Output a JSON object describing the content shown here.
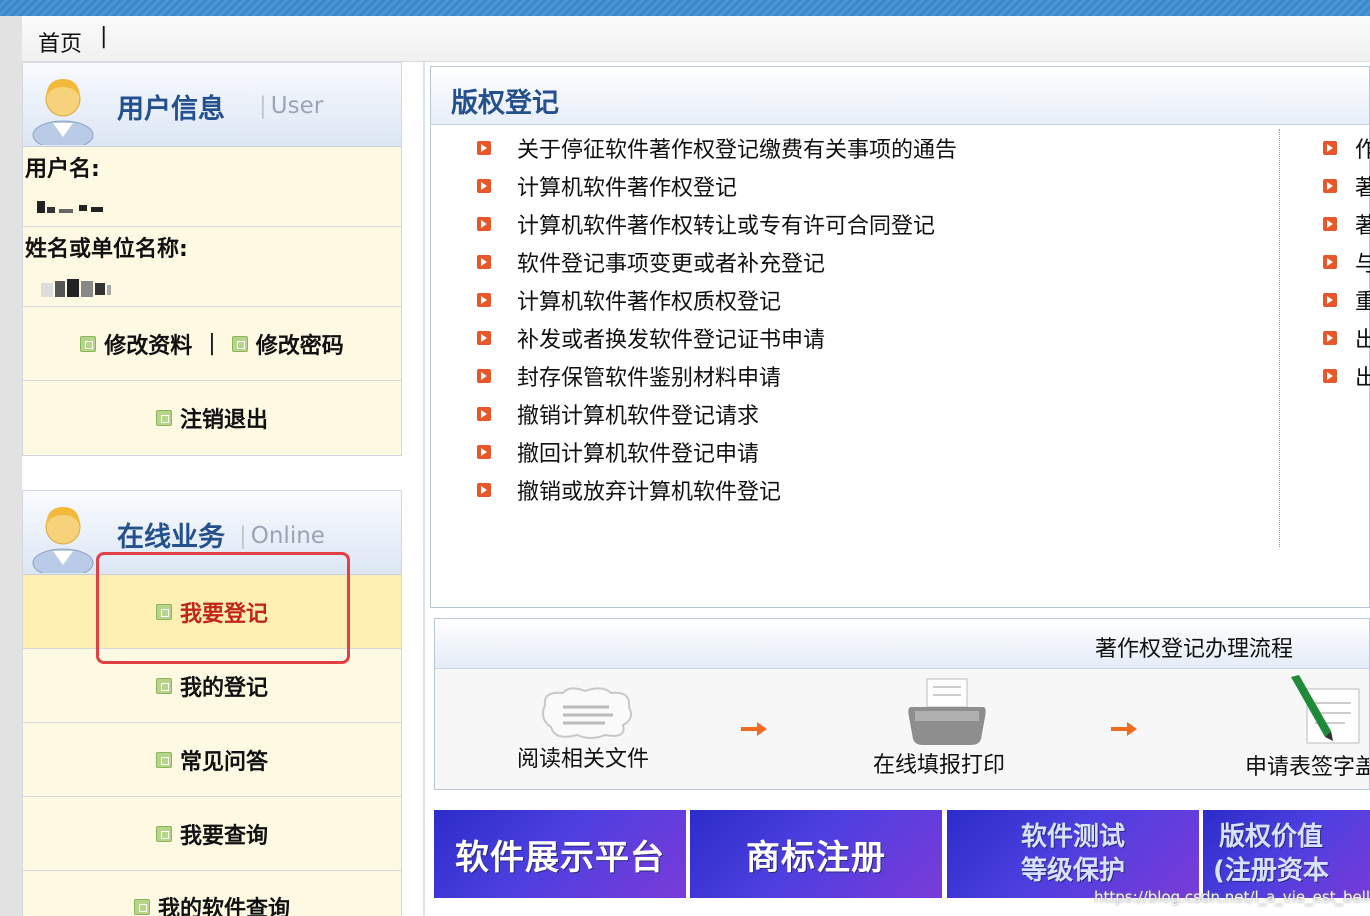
{
  "nav": {
    "home": "首页",
    "separator": "|"
  },
  "user_panel": {
    "title": "用户信息",
    "subtitle": "User",
    "username_label": "用户名:",
    "name_label": "姓名或单位名称:",
    "edit_profile": "修改资料",
    "link_separator": "|",
    "change_password": "修改密码",
    "logout": "注销退出"
  },
  "online_panel": {
    "title": "在线业务",
    "subtitle": "Online",
    "items": [
      "我要登记",
      "我的登记",
      "常见问答",
      "我要查询",
      "我的软件查询"
    ]
  },
  "copyright_box": {
    "title": "版权登记",
    "items": [
      "关于停征软件著作权登记缴费有关事项的通告",
      "计算机软件著作权登记",
      "计算机软件著作权转让或专有许可合同登记",
      "软件登记事项变更或者补充登记",
      "计算机软件著作权质权登记",
      "补发或者换发软件登记证书申请",
      "封存保管软件鉴别材料申请",
      "撤销计算机软件登记请求",
      "撤回计算机软件登记申请",
      "撤销或放弃计算机软件登记"
    ],
    "right_items": [
      "作",
      "著",
      "著",
      "与",
      "重",
      "出",
      "出"
    ]
  },
  "flow": {
    "title": "著作权登记办理流程",
    "steps": [
      "阅读相关文件",
      "在线填报打印",
      "申请表签字盖"
    ]
  },
  "banners": [
    {
      "line1": "软件展示平台"
    },
    {
      "line1": "商标注册"
    },
    {
      "line1": "软件测试",
      "line2": "等级保护"
    },
    {
      "line1": "版权价值",
      "line2": "(注册资本"
    }
  ],
  "watermark": "https://blog.csdn.net/l_a_vie_est_belle",
  "colors": {
    "accent_blue": "#24508e",
    "highlight_red": "#c0261a",
    "annotation_red": "#e14045"
  }
}
